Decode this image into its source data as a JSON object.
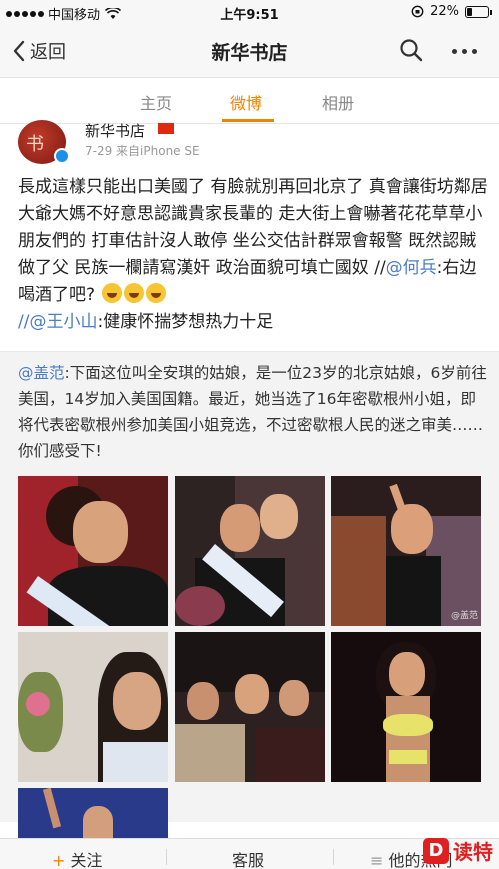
{
  "status_bar": {
    "carrier": "中国移动",
    "time": "上午9:51",
    "battery": "22%",
    "battery_level": 0.22
  },
  "nav": {
    "back_label": "返回",
    "title": "新华书店"
  },
  "tabs": [
    {
      "label": "主页",
      "active": false
    },
    {
      "label": "微博",
      "active": true
    },
    {
      "label": "相册",
      "active": false
    }
  ],
  "post": {
    "author": "新华书店",
    "meta": "7-29  来自iPhone SE",
    "text_main": "長成這樣只能出口美國了 有臉就別再回北京了 真會讓街坊鄰居大爺大媽不好意思認識貴家長輩的 走大街上會嚇著花花草草小朋友們的 打車估計沒人敢停 坐公交估計群眾會報警 既然認賊做了父 民族一欄請寫漢奸 政治面貌可填亡國奴 //",
    "mention_1": "@何兵",
    "text_after_mention_1": ":右边喝酒了吧?",
    "mention_2": "//@王小山",
    "text_after_mention_2": ":健康怀揣梦想热力十足"
  },
  "repost": {
    "mention": "@盖范",
    "text": ":下面这位叫全安琪的姑娘，是一位23岁的北京姑娘，6岁前往美国，14岁加入美国国籍。最近，她当选了16年密歇根州小姐，即将代表密歇根州参加美国小姐竞选，不过密歇根人民的迷之审美……你们感受下!",
    "photo_watermark": "@盖范"
  },
  "bottom_bar": {
    "follow_plus": "+",
    "follow": "关注",
    "service": "客服",
    "menu_glyph": "≡",
    "theirs": "他的热门"
  },
  "watermark": {
    "logo_letter": "D",
    "text": "读特"
  },
  "colors": {
    "accent": "#f08300",
    "link": "#4a7cc7",
    "repost_bg": "#f3f3f3"
  }
}
